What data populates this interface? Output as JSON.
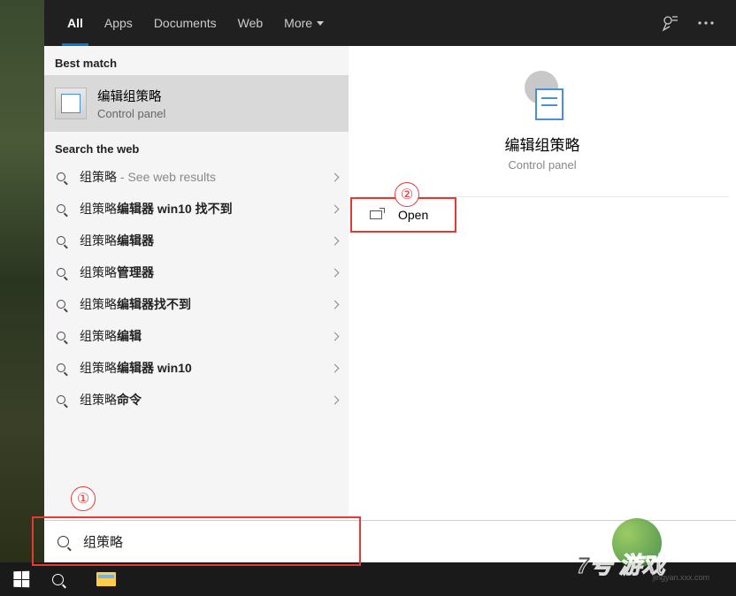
{
  "tabs": {
    "all": "All",
    "apps": "Apps",
    "documents": "Documents",
    "web": "Web",
    "more": "More"
  },
  "left": {
    "best_match_header": "Best match",
    "best_match": {
      "title": "编辑组策略",
      "subtitle": "Control panel"
    },
    "search_web_header": "Search the web",
    "web_items": [
      {
        "prefix": "组策略",
        "suffix": " - See web results",
        "suffix_bold": false
      },
      {
        "prefix": "组策略",
        "suffix": "编辑器 win10 找不到",
        "suffix_bold": true
      },
      {
        "prefix": "组策略",
        "suffix": "编辑器",
        "suffix_bold": true
      },
      {
        "prefix": "组策略",
        "suffix": "管理器",
        "suffix_bold": true
      },
      {
        "prefix": "组策略",
        "suffix": "编辑器找不到",
        "suffix_bold": true
      },
      {
        "prefix": "组策略",
        "suffix": "编辑",
        "suffix_bold": true
      },
      {
        "prefix": "组策略",
        "suffix": "编辑器 win10",
        "suffix_bold": true
      },
      {
        "prefix": "组策略",
        "suffix": "命令",
        "suffix_bold": true
      }
    ]
  },
  "right": {
    "title": "编辑组策略",
    "subtitle": "Control panel",
    "open_label": "Open"
  },
  "searchbox": {
    "query": "组策略"
  },
  "callouts": {
    "one": "①",
    "two": "②"
  },
  "watermark": {
    "text": "7号 游戏",
    "url": "jingyan.xxx.com"
  }
}
